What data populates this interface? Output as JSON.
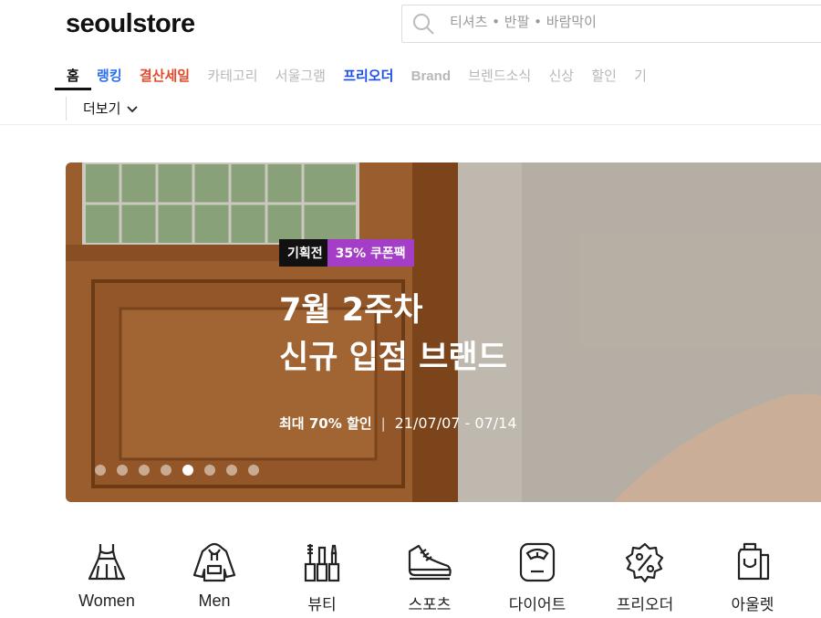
{
  "header": {
    "logo": "seoulstore",
    "search_placeholder": "티셔츠 • 반팔 • 바람막이"
  },
  "nav": {
    "items": [
      {
        "label": "홈"
      },
      {
        "label": "랭킹"
      },
      {
        "label": "결산세일"
      },
      {
        "label": "카테고리"
      },
      {
        "label": "서울그램"
      },
      {
        "label": "프리오더"
      },
      {
        "label": "Brand"
      },
      {
        "label": "브렌드소식"
      },
      {
        "label": "신상"
      },
      {
        "label": "할인"
      },
      {
        "label": "기"
      }
    ],
    "more_label": "더보기"
  },
  "banner": {
    "tag1": "기획전",
    "tag2": "35% 쿠폰팩",
    "title_line1": "7월 2주차",
    "title_line2": "신규 입점 브랜드",
    "subtitle": "최대 70% 할인",
    "separator": "|",
    "date": "21/07/07 - 07/14",
    "slide_count": 8,
    "active_slide": 5
  },
  "categories": [
    {
      "label": "Women",
      "icon": "dress-icon"
    },
    {
      "label": "Men",
      "icon": "hoodie-icon"
    },
    {
      "label": "뷰티",
      "icon": "cosmetics-icon"
    },
    {
      "label": "스포츠",
      "icon": "sneaker-icon"
    },
    {
      "label": "다이어트",
      "icon": "scale-icon"
    },
    {
      "label": "프리오더",
      "icon": "percent-badge-icon"
    },
    {
      "label": "아울렛",
      "icon": "shopping-bag-icon"
    }
  ],
  "colors": {
    "ranking": "#2b6ef0",
    "sale": "#e24a2a",
    "preorder": "#1d4ee8",
    "coupon_tag": "#a43ec6"
  }
}
